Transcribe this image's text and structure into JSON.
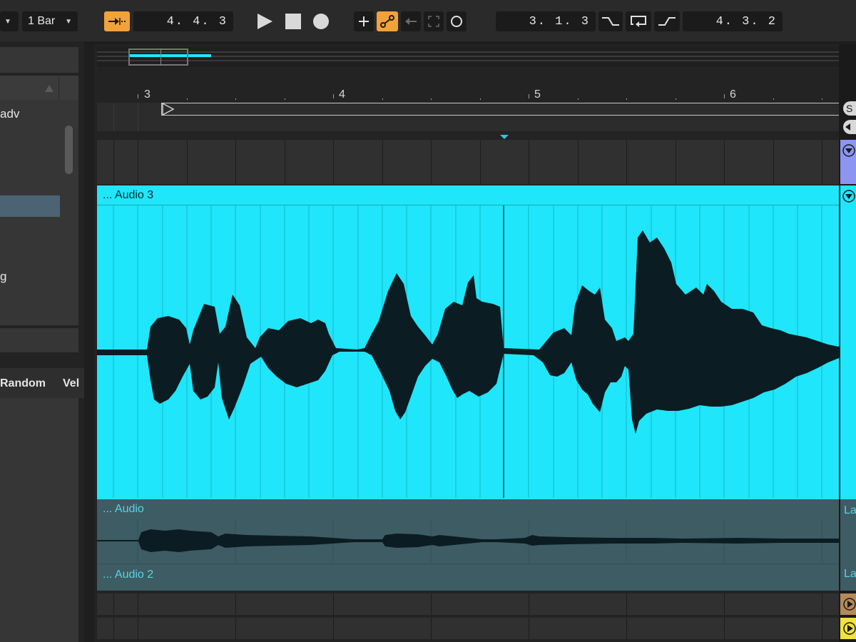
{
  "transport": {
    "quantize_label": "1 Bar",
    "follow_icon": "follow-arrow-icon",
    "loop_start": "4. 4. 3",
    "play_icon": "play-icon",
    "stop_icon": "stop-icon",
    "record_icon": "record-icon",
    "add_icon": "plus-icon",
    "automation_icon": "automation-curve-icon",
    "back_icon": "back-arrow-icon",
    "capture_icon": "capture-bracket-icon",
    "session_record_icon": "circle-icon",
    "position": "3. 1. 3",
    "punch_in_icon": "punch-in-icon",
    "loop_icon": "loop-icon",
    "punch_out_icon": "punch-out-icon",
    "loop_length": "4. 3. 2",
    "accent_color": "#f3a23a"
  },
  "browser": {
    "item_adv": "adv",
    "item_g": "g",
    "random_label": "Random",
    "vel_label": "Vel"
  },
  "ruler": {
    "bars": [
      "3",
      "4",
      "5",
      "6"
    ]
  },
  "tracks": {
    "main_clip_title": "... Audio 3",
    "main_clip_color": "#1fe6fa",
    "take_lane_1": "... Audio",
    "take_lane_2": "... Audio 2",
    "lane_label_1": "La",
    "lane_label_2": "La",
    "right_label_s": "S"
  }
}
